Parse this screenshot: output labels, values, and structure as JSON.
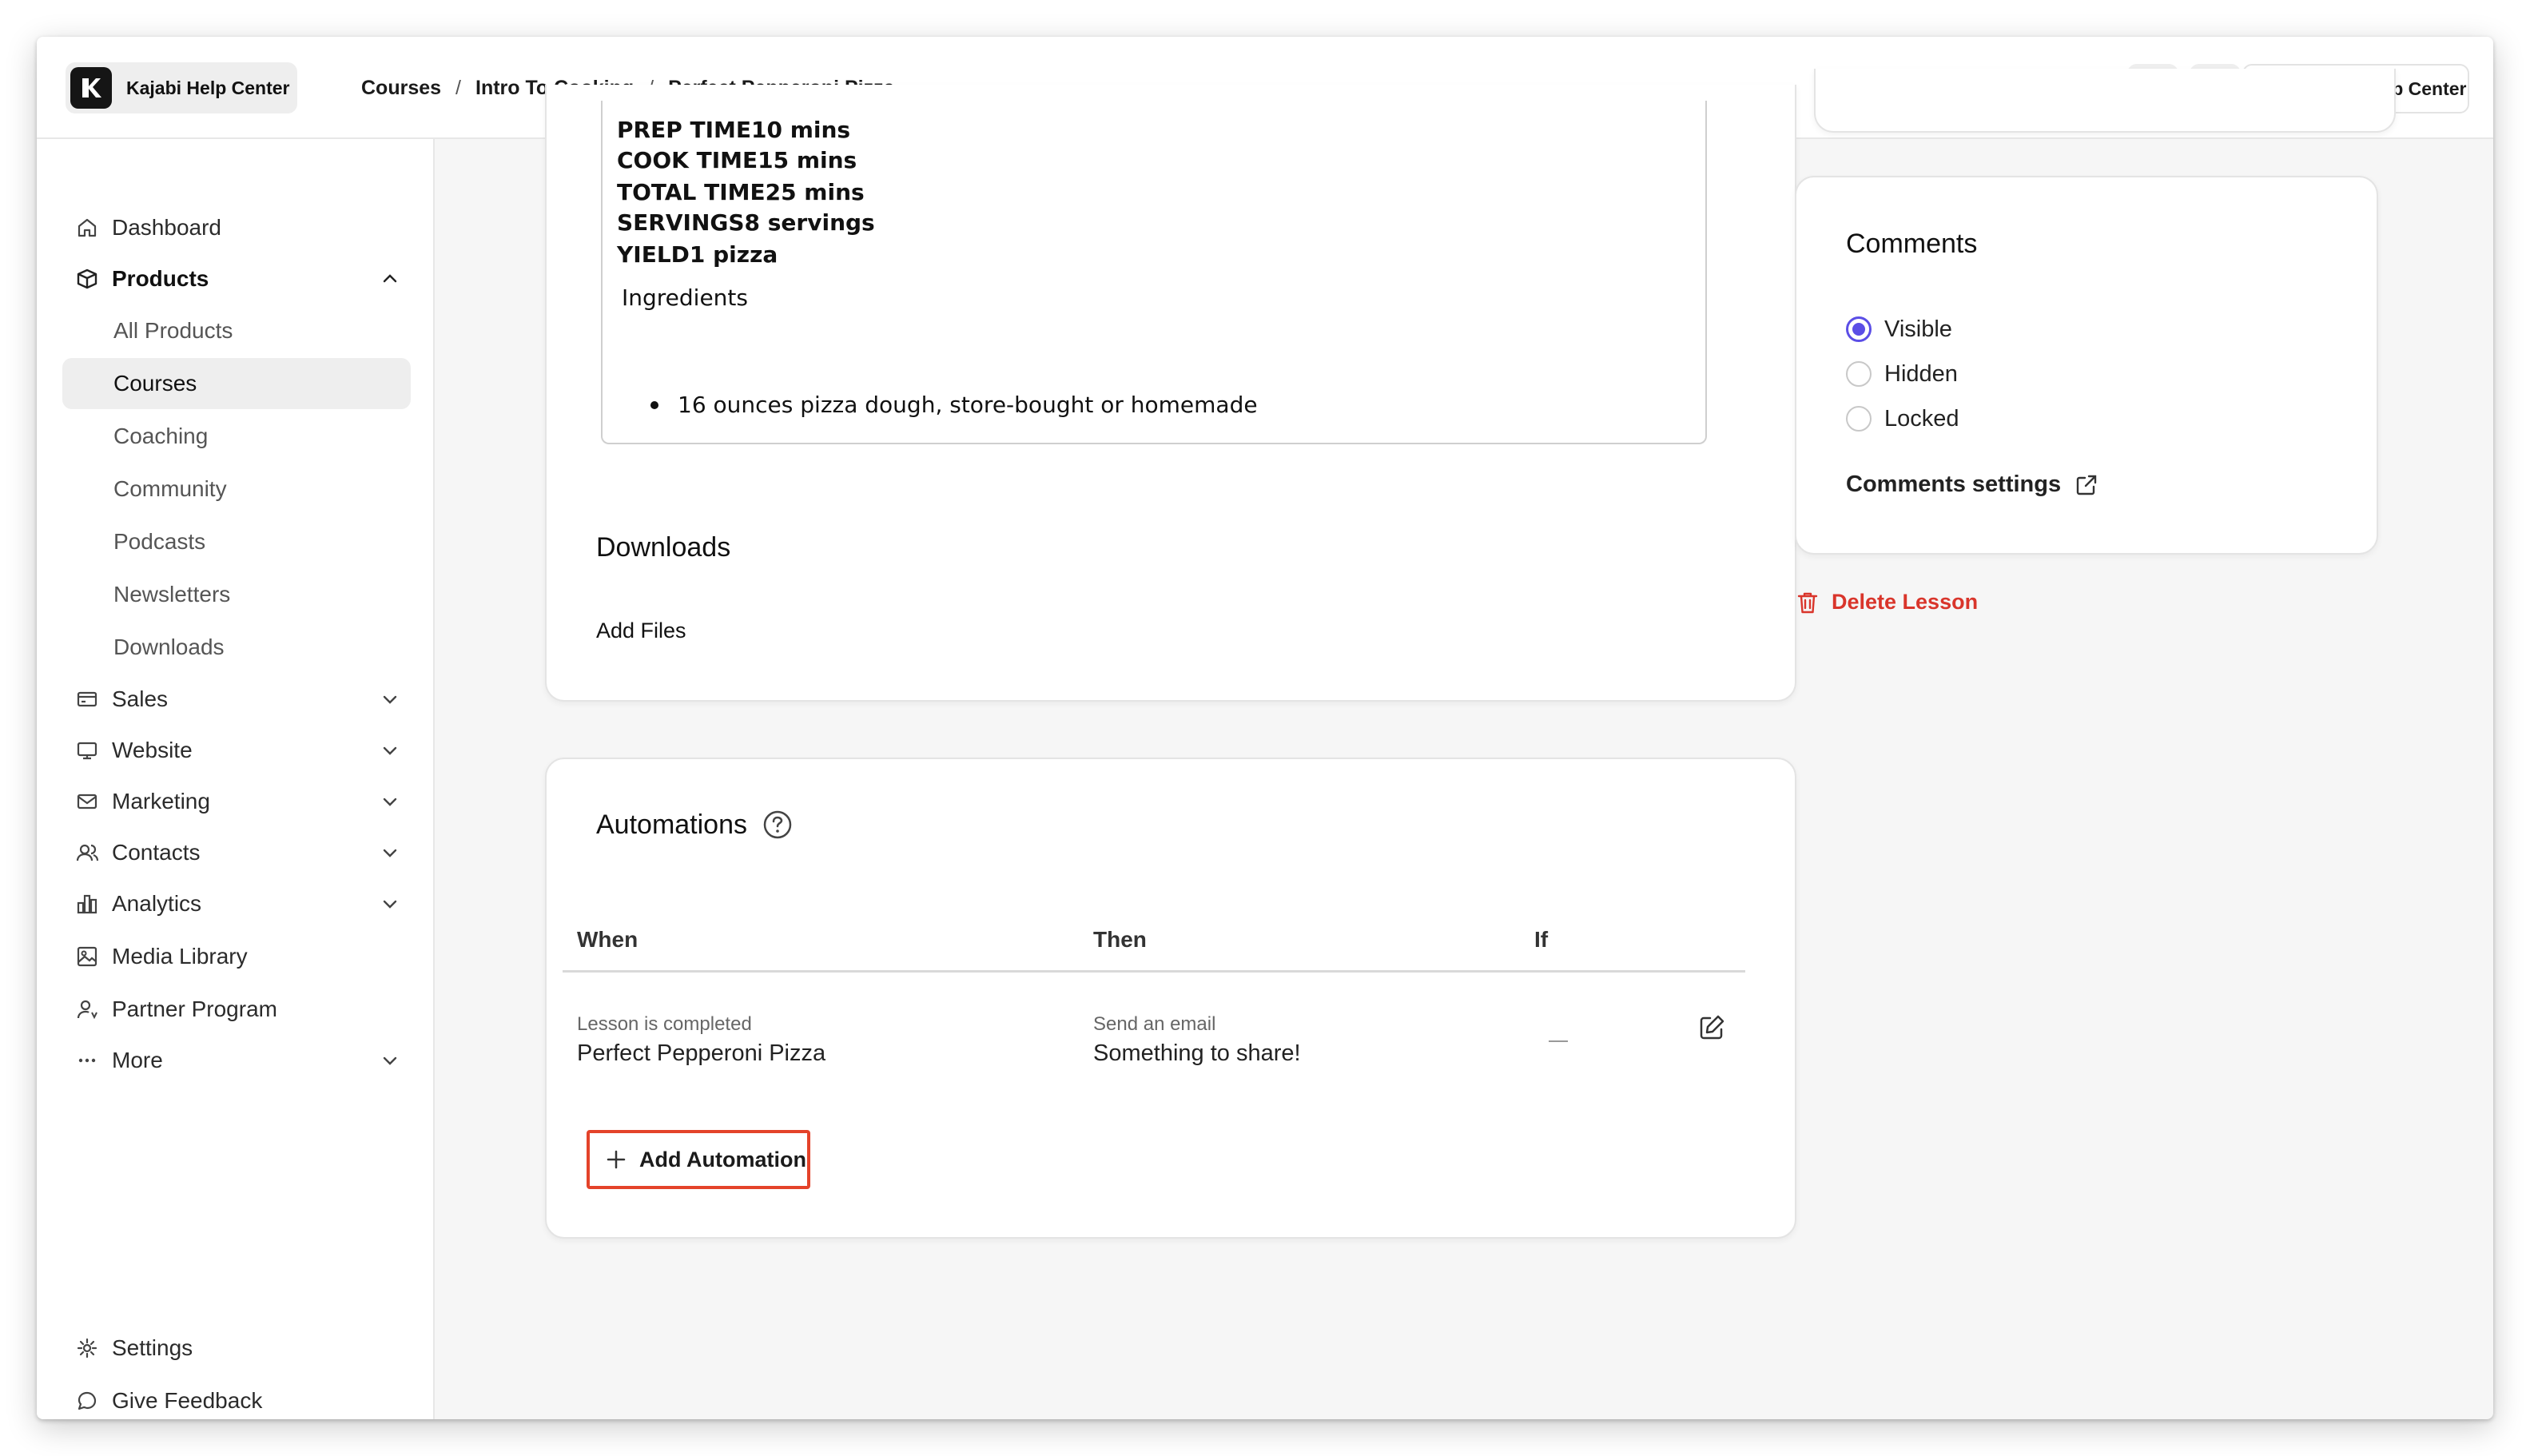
{
  "brand": {
    "name": "Kajabi Help Center"
  },
  "breadcrumb": [
    "Courses",
    "Intro To Cooking",
    "Perfect Pepperoni Pizza"
  ],
  "topbar": {
    "user_name": "Kajabi Help Center"
  },
  "sidebar": {
    "items": [
      {
        "label": "Dashboard",
        "icon": "home-icon"
      },
      {
        "label": "Products",
        "icon": "box-icon",
        "expanded": true
      },
      {
        "label": "Sales",
        "icon": "credit-card-icon"
      },
      {
        "label": "Website",
        "icon": "monitor-icon"
      },
      {
        "label": "Marketing",
        "icon": "mail-icon"
      },
      {
        "label": "Contacts",
        "icon": "users-icon"
      },
      {
        "label": "Analytics",
        "icon": "bar-chart-icon"
      },
      {
        "label": "Media Library",
        "icon": "image-icon"
      },
      {
        "label": "Partner Program",
        "icon": "partner-icon"
      },
      {
        "label": "More",
        "icon": "more-icon"
      }
    ],
    "products_sub": [
      "All Products",
      "Courses",
      "Coaching",
      "Community",
      "Podcasts",
      "Newsletters",
      "Downloads"
    ],
    "active_sub": "Courses",
    "footer": [
      {
        "label": "Settings",
        "icon": "gear-icon"
      },
      {
        "label": "Give Feedback",
        "icon": "chat-bubble-icon"
      }
    ]
  },
  "recipe": {
    "lines": [
      "PREP TIME10 mins",
      "COOK TIME15 mins",
      "TOTAL TIME25 mins",
      "SERVINGS8 servings",
      "YIELD1 pizza"
    ],
    "ingredients_label": "Ingredients",
    "bullets": [
      "16 ounces pizza dough, store-bought or homemade"
    ]
  },
  "downloads": {
    "title": "Downloads",
    "add_files": "Add Files"
  },
  "automations": {
    "title": "Automations",
    "columns": {
      "when": "When",
      "then": "Then",
      "if": "If"
    },
    "rows": [
      {
        "when_small": "Lesson is completed",
        "when_main": "Perfect Pepperoni Pizza",
        "then_small": "Send an email",
        "then_main": "Something to share!"
      }
    ],
    "add_label": "Add Automation"
  },
  "comments": {
    "title": "Comments",
    "options": [
      "Visible",
      "Hidden",
      "Locked"
    ],
    "selected": "Visible",
    "settings_label": "Comments settings"
  },
  "delete_lesson": "Delete Lesson",
  "colors": {
    "accent": "#5b4ee6",
    "danger": "#d9352b",
    "highlight": "#e4432a"
  }
}
